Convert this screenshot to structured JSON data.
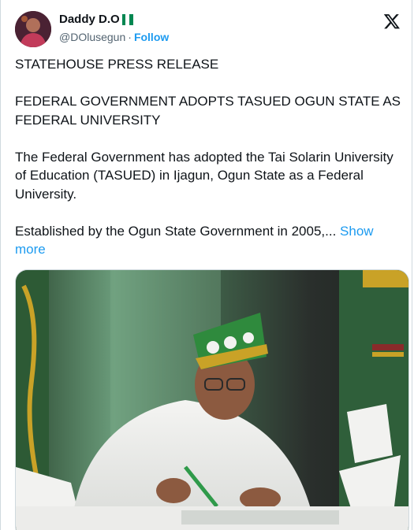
{
  "author": {
    "display_name": "Daddy D.O",
    "handle": "@DOlusegun",
    "separator": "·",
    "follow_label": "Follow",
    "flag_colors": [
      "#008751",
      "#ffffff",
      "#008751"
    ]
  },
  "platform": {
    "logo_icon": "x-logo-icon"
  },
  "tweet": {
    "paragraphs": [
      "STATEHOUSE PRESS RELEASE",
      "FEDERAL GOVERNMENT ADOPTS TASUED OGUN STATE AS FEDERAL UNIVERSITY",
      "The Federal Government has adopted the Tai Solarin University of Education (TASUED) in Ijagun, Ogun State as a Federal University."
    ],
    "last_paragraph": "Established by the Ogun State Government in 2005,...",
    "show_more_label": "Show more"
  },
  "media": {
    "kind": "photo",
    "accent_colors": [
      "#2f8a3d",
      "#f2f2f0",
      "#c9a227",
      "#8a2a2a"
    ]
  }
}
